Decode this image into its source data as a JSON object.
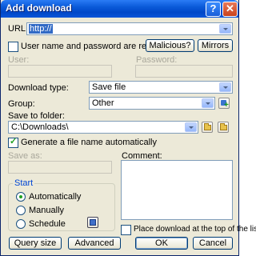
{
  "window": {
    "title": "Add download",
    "help_label": "?",
    "close_label": "✕"
  },
  "url": {
    "label": "URL:",
    "value": "http://"
  },
  "auth": {
    "checkbox_label": "User name and password are required",
    "malicious_label": "Malicious?",
    "mirrors_label": "Mirrors",
    "user_label": "User:",
    "password_label": "Password:"
  },
  "download_type": {
    "label": "Download type:",
    "value": "Save file"
  },
  "group": {
    "label": "Group:",
    "value": "Other"
  },
  "save_to": {
    "label": "Save to folder:",
    "value": "C:\\Downloads\\"
  },
  "generate": {
    "label": "Generate a file name automatically",
    "checked": true
  },
  "save_as": {
    "label": "Save as:"
  },
  "comment": {
    "label": "Comment:"
  },
  "start": {
    "legend": "Start",
    "options": [
      "Automatically",
      "Manually",
      "Schedule"
    ],
    "selected": "Automatically"
  },
  "top_of_list": {
    "label": "Place download at the top of the list"
  },
  "buttons": {
    "query_size": "Query size",
    "advanced": "Advanced",
    "ok": "OK",
    "cancel": "Cancel"
  },
  "icons": {
    "add_group": "add-group-icon",
    "browse_folder": "folder-icon",
    "open_folder": "open-folder-icon",
    "schedule": "schedule-icon"
  }
}
